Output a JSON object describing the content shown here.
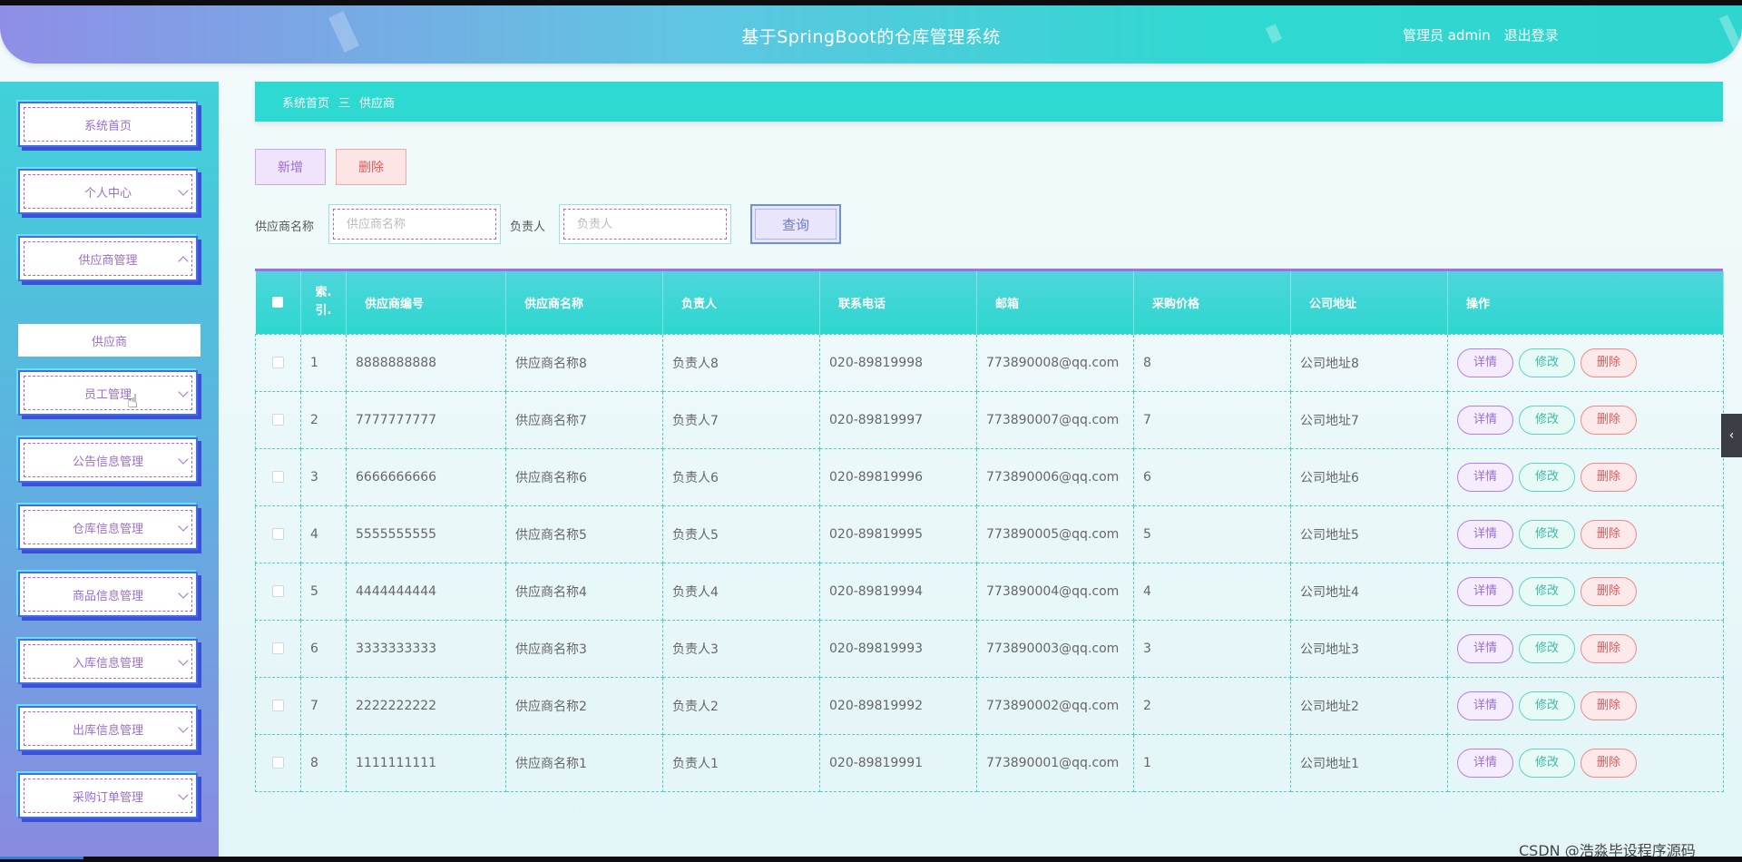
{
  "header": {
    "title": "基于SpringBoot的仓库管理系统",
    "user_role": "管理员 admin",
    "logout": "退出登录"
  },
  "sidebar": {
    "items": [
      {
        "label": "系统首页"
      },
      {
        "label": "个人中心"
      },
      {
        "label": "供应商管理"
      },
      {
        "label": "员工管理"
      },
      {
        "label": "公告信息管理"
      },
      {
        "label": "仓库信息管理"
      },
      {
        "label": "商品信息管理"
      },
      {
        "label": "入库信息管理"
      },
      {
        "label": "出库信息管理"
      },
      {
        "label": "采购订单管理"
      }
    ],
    "sub_item": "供应商"
  },
  "breadcrumb": {
    "home": "系统首页",
    "separator": "三",
    "current": "供应商"
  },
  "toolbar": {
    "add_label": "新增",
    "delete_label": "删除"
  },
  "search": {
    "supplier_name_label": "供应商名称",
    "supplier_name_placeholder": "供应商名称",
    "contact_label": "负责人",
    "contact_placeholder": "负责人",
    "query_label": "查询"
  },
  "table": {
    "headers": {
      "index": "索.\n引.",
      "code": "供应商编号",
      "name": "供应商名称",
      "contact": "负责人",
      "phone": "联系电话",
      "email": "邮箱",
      "price": "采购价格",
      "address": "公司地址",
      "ops": "操作"
    },
    "rows": [
      {
        "idx": "1",
        "code": "8888888888",
        "name": "供应商名称8",
        "contact": "负责人8",
        "phone": "020-89819998",
        "email": "773890008@qq.com",
        "price": "8",
        "address": "公司地址8"
      },
      {
        "idx": "2",
        "code": "7777777777",
        "name": "供应商名称7",
        "contact": "负责人7",
        "phone": "020-89819997",
        "email": "773890007@qq.com",
        "price": "7",
        "address": "公司地址7"
      },
      {
        "idx": "3",
        "code": "6666666666",
        "name": "供应商名称6",
        "contact": "负责人6",
        "phone": "020-89819996",
        "email": "773890006@qq.com",
        "price": "6",
        "address": "公司地址6"
      },
      {
        "idx": "4",
        "code": "5555555555",
        "name": "供应商名称5",
        "contact": "负责人5",
        "phone": "020-89819995",
        "email": "773890005@qq.com",
        "price": "5",
        "address": "公司地址5"
      },
      {
        "idx": "5",
        "code": "4444444444",
        "name": "供应商名称4",
        "contact": "负责人4",
        "phone": "020-89819994",
        "email": "773890004@qq.com",
        "price": "4",
        "address": "公司地址4"
      },
      {
        "idx": "6",
        "code": "3333333333",
        "name": "供应商名称3",
        "contact": "负责人3",
        "phone": "020-89819993",
        "email": "773890003@qq.com",
        "price": "3",
        "address": "公司地址3"
      },
      {
        "idx": "7",
        "code": "2222222222",
        "name": "供应商名称2",
        "contact": "负责人2",
        "phone": "020-89819992",
        "email": "773890002@qq.com",
        "price": "2",
        "address": "公司地址2"
      },
      {
        "idx": "8",
        "code": "1111111111",
        "name": "供应商名称1",
        "contact": "负责人1",
        "phone": "020-89819991",
        "email": "773890001@qq.com",
        "price": "1",
        "address": "公司地址1"
      }
    ],
    "ops": {
      "detail": "详情",
      "edit": "修改",
      "delete": "删除"
    }
  },
  "watermark": "CSDN @浩淼毕设程序源码",
  "icons": {
    "right_tab": "chevron-left-icon",
    "cursor": "hand-pointer-icon"
  },
  "colors": {
    "accent_teal": "#2ed9d1",
    "accent_purple": "#9a6fd0",
    "danger": "#e05a5a"
  }
}
